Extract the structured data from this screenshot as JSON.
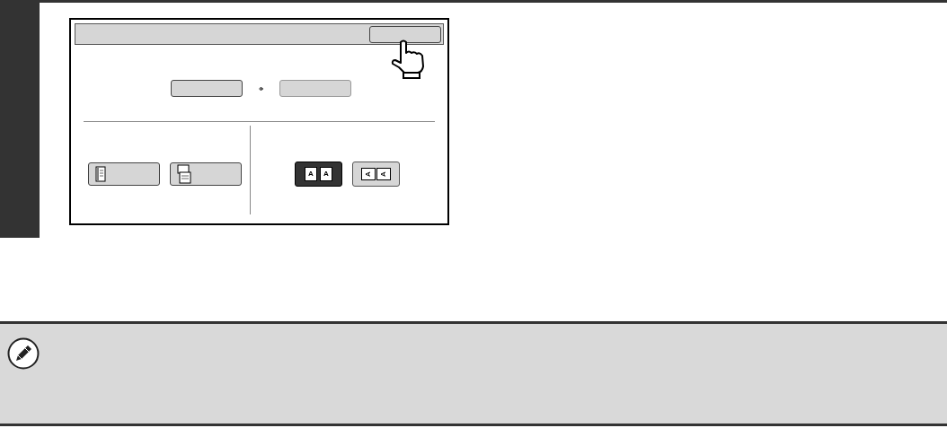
{
  "dialog": {
    "size_buttons": [
      {
        "disabled": false
      },
      {
        "disabled": true
      }
    ],
    "binding_buttons": [
      {
        "kind": "left"
      },
      {
        "kind": "top"
      }
    ],
    "orientation_buttons": [
      {
        "kind": "portrait",
        "glyphs": [
          "A",
          "A"
        ],
        "selected": true
      },
      {
        "kind": "landscape",
        "glyphs": [
          "A",
          "A"
        ],
        "selected": false
      }
    ]
  },
  "note": {
    "kind": "pencil"
  }
}
